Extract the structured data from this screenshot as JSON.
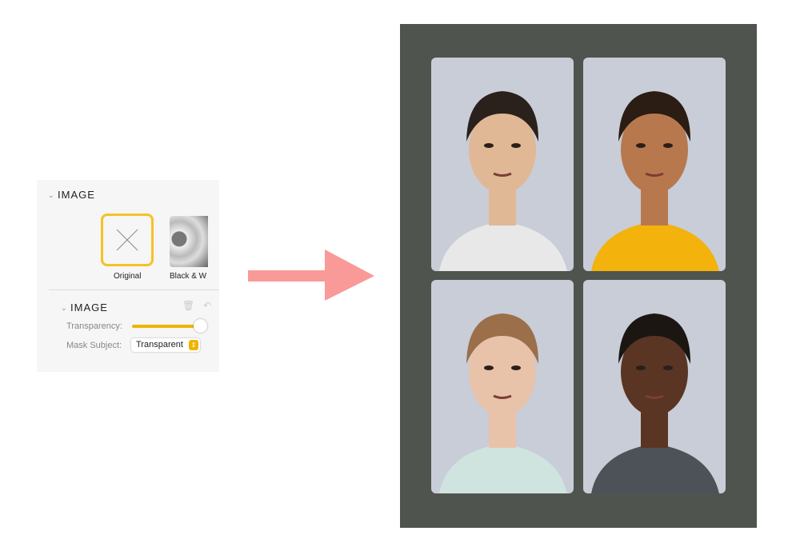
{
  "panel": {
    "section_title": "IMAGE",
    "filters": [
      {
        "label": "Original",
        "selected": true
      },
      {
        "label": "Black & W",
        "selected": false
      }
    ],
    "sub_section_title": "IMAGE",
    "transparency_label": "Transparency:",
    "transparency_value": 100,
    "mask_label": "Mask Subject:",
    "mask_value": "Transparent"
  },
  "colors": {
    "accent": "#f5c226",
    "arrow": "#f99a98",
    "canvas": "#4f544f",
    "card": "#c8cdd7"
  },
  "photos": [
    {
      "name": "portrait-man-dark-hair",
      "skin": "#e0b896",
      "hair": "#2a211c",
      "shirt": "#e8e8e8"
    },
    {
      "name": "portrait-woman-yellow-hoodie",
      "skin": "#b8784e",
      "hair": "#2b1c14",
      "shirt": "#f3b20c"
    },
    {
      "name": "portrait-woman-blonde",
      "skin": "#e9c2aa",
      "hair": "#9a6f4a",
      "shirt": "#cfe3df"
    },
    {
      "name": "portrait-man-red-tie",
      "skin": "#5a3524",
      "hair": "#1c1613",
      "shirt": "#4d5258"
    }
  ]
}
